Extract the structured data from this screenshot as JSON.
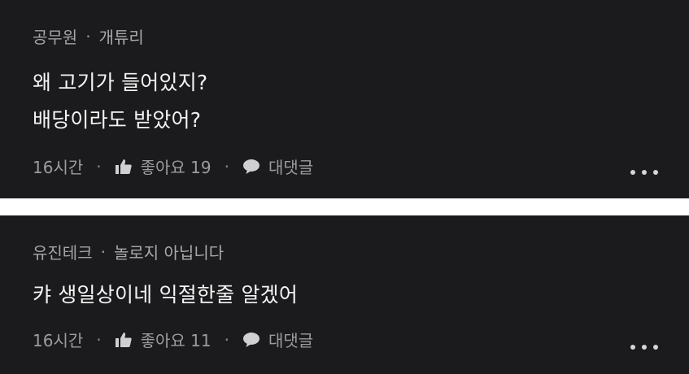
{
  "comments": [
    {
      "author": "공무원",
      "tag": "개튜리",
      "lines": [
        "왜 고기가 들어있지?",
        "배당이라도 받았어?"
      ],
      "time": "16시간",
      "like_label": "좋아요 19",
      "reply_label": "대댓글"
    },
    {
      "author": "유진테크",
      "tag": "놀로지 아닙니다",
      "lines": [
        "캬 생일상이네 익절한줄 알겠어"
      ],
      "time": "16시간",
      "like_label": "좋아요 11",
      "reply_label": "대댓글"
    }
  ],
  "separator": "·",
  "icons": {
    "like": "thumbs-up-icon",
    "reply": "speech-bubble-icon",
    "more": "more-horizontal-icon"
  }
}
